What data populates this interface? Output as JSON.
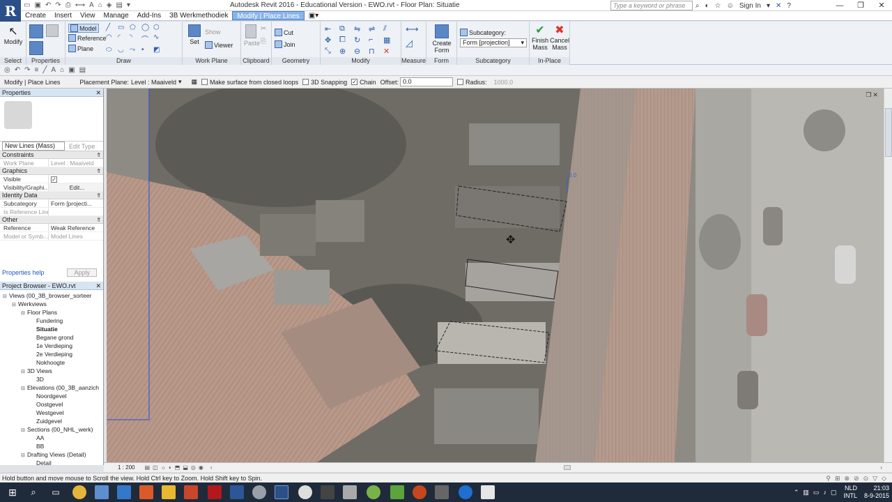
{
  "title_bar": {
    "app_logo": "R",
    "title": "Autodesk Revit 2016 - Educational Version -   EWO.rvt - Floor Plan: Situatie",
    "search_placeholder": "Type a keyword or phrase",
    "sign_in": "Sign In"
  },
  "menu_tabs": [
    "Create",
    "Insert",
    "View",
    "Manage",
    "Add-Ins",
    "3B Werkmethodiek",
    "Modify | Place Lines"
  ],
  "active_tab": "Modify | Place Lines",
  "ribbon": {
    "select_panel": {
      "label": "Select",
      "modify": "Modify"
    },
    "properties_panel": {
      "label": "Properties"
    },
    "draw_panel": {
      "label": "Draw",
      "model": "Model",
      "reference": "Reference",
      "plane": "Plane"
    },
    "work_plane_panel": {
      "label": "Work Plane",
      "set": "Set",
      "show": "Show",
      "viewer": "Viewer"
    },
    "clipboard_panel": {
      "label": "Clipboard",
      "paste": "Paste"
    },
    "geometry_panel": {
      "label": "Geometry",
      "cut": "Cut",
      "join": "Join"
    },
    "modify_panel": {
      "label": "Modify"
    },
    "measure_panel": {
      "label": "Measure"
    },
    "form_panel": {
      "label": "Form",
      "create_form": "Create Form"
    },
    "subcategory_panel": {
      "label": "Subcategory",
      "caption": "Subcategory:",
      "value": "Form [projection]"
    },
    "inplace_panel": {
      "label": "In-Place Editor",
      "finish": "Finish Mass",
      "cancel": "Cancel Mass"
    }
  },
  "options_bar": {
    "context": "Modify | Place Lines",
    "placement_plane_label": "Placement Plane:",
    "placement_plane_value": "Level : Maaiveld",
    "make_surface": "Make surface from closed loops",
    "snapping_3d": "3D Snapping",
    "chain": "Chain",
    "chain_checked": true,
    "offset_label": "Offset:",
    "offset_value": "0.0",
    "radius_label": "Radius:",
    "radius_value": "1000.0"
  },
  "properties": {
    "header": "Properties",
    "type": "New Lines (Mass)",
    "edit_type": "Edit Type",
    "categories": [
      {
        "name": "Constraints",
        "rows": [
          {
            "k": "Work Plane",
            "v": "Level : Maaiveld",
            "dim": true
          }
        ]
      },
      {
        "name": "Graphics",
        "rows": [
          {
            "k": "Visible",
            "v": "",
            "check": true
          },
          {
            "k": "Visibility/Graphi...",
            "v": "Edit..."
          }
        ]
      },
      {
        "name": "Identity Data",
        "rows": [
          {
            "k": "Subcategory",
            "v": "Form [projecti..."
          },
          {
            "k": "Is Reference Line",
            "v": "",
            "dim": true
          }
        ]
      },
      {
        "name": "Other",
        "rows": [
          {
            "k": "Reference",
            "v": "Weak Reference"
          },
          {
            "k": "Model or Symb...",
            "v": "Model Lines",
            "dim": true
          }
        ]
      }
    ],
    "help": "Properties help",
    "apply": "Apply"
  },
  "project_browser": {
    "header": "Project Browser - EWO.rvt",
    "items": [
      {
        "label": "Views (00_3B_browser_sorteer",
        "level": 0,
        "toggle": "-"
      },
      {
        "label": "Werkviews",
        "level": 1,
        "toggle": "-"
      },
      {
        "label": "Floor Plans",
        "level": 2,
        "toggle": "-"
      },
      {
        "label": "Fundering",
        "level": 3,
        "toggle": ""
      },
      {
        "label": "Situatie",
        "level": 3,
        "toggle": "",
        "bold": true
      },
      {
        "label": "Begane grond",
        "level": 3,
        "toggle": ""
      },
      {
        "label": "1e Verdieping",
        "level": 3,
        "toggle": ""
      },
      {
        "label": "2e Verdieping",
        "level": 3,
        "toggle": ""
      },
      {
        "label": "Nokhoogte",
        "level": 3,
        "toggle": ""
      },
      {
        "label": "3D Views",
        "level": 2,
        "toggle": "-"
      },
      {
        "label": "3D",
        "level": 3,
        "toggle": ""
      },
      {
        "label": "Elevations (00_3B_aanzich",
        "level": 2,
        "toggle": "-"
      },
      {
        "label": "Noordgevel",
        "level": 3,
        "toggle": ""
      },
      {
        "label": "Oostgevel",
        "level": 3,
        "toggle": ""
      },
      {
        "label": "Westgevel",
        "level": 3,
        "toggle": ""
      },
      {
        "label": "Zuidgevel",
        "level": 3,
        "toggle": ""
      },
      {
        "label": "Sections (00_NHL_werk)",
        "level": 2,
        "toggle": "-"
      },
      {
        "label": "AA",
        "level": 3,
        "toggle": ""
      },
      {
        "label": "BB",
        "level": 3,
        "toggle": ""
      },
      {
        "label": "Drafting Views (Detail)",
        "level": 2,
        "toggle": "-"
      },
      {
        "label": "Detail",
        "level": 3,
        "toggle": ""
      }
    ]
  },
  "view": {
    "scale": "1 : 200",
    "dim_label": "0.0"
  },
  "status": "Hold button and move mouse to Scroll the view. Hold Ctrl key to Zoom. Hold Shift key to Spin.",
  "taskbar": {
    "lang": "NLD",
    "kb": "INTL",
    "time": "21:03",
    "date": "8-9-2015"
  }
}
